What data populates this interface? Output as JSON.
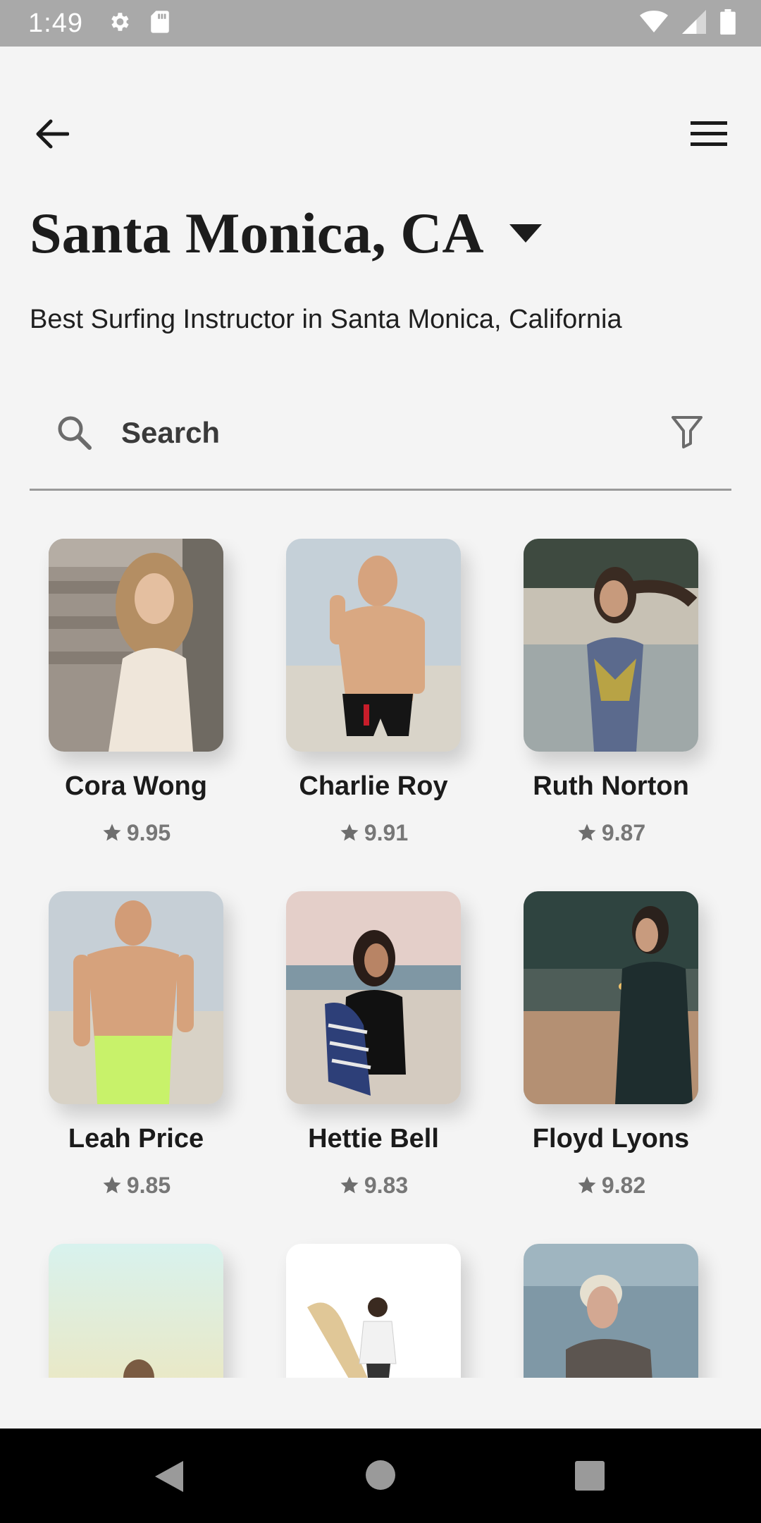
{
  "status_bar": {
    "time": "1:49",
    "icons": [
      "gear-icon",
      "sd-card-icon",
      "wifi-icon",
      "signal-icon",
      "battery-icon"
    ]
  },
  "header": {
    "back_icon": "arrow-left-icon",
    "menu_icon": "hamburger-menu-icon",
    "location_title": "Santa Monica, CA",
    "subtitle": "Best Surfing Instructor in Santa Monica, California"
  },
  "search": {
    "placeholder": "Search",
    "value": "",
    "filter_icon": "filter-icon"
  },
  "instructors": [
    {
      "name": "Cora Wong",
      "rating": "9.95"
    },
    {
      "name": "Charlie Roy",
      "rating": "9.91"
    },
    {
      "name": "Ruth Norton",
      "rating": "9.87"
    },
    {
      "name": "Leah Price",
      "rating": "9.85"
    },
    {
      "name": "Hettie Bell",
      "rating": "9.83"
    },
    {
      "name": "Floyd Lyons",
      "rating": "9.82"
    }
  ],
  "colors": {
    "background": "#f4f4f4",
    "status_bar": "#a9a9a9",
    "rating_gray": "#777777",
    "nav_bar": "#000000"
  }
}
